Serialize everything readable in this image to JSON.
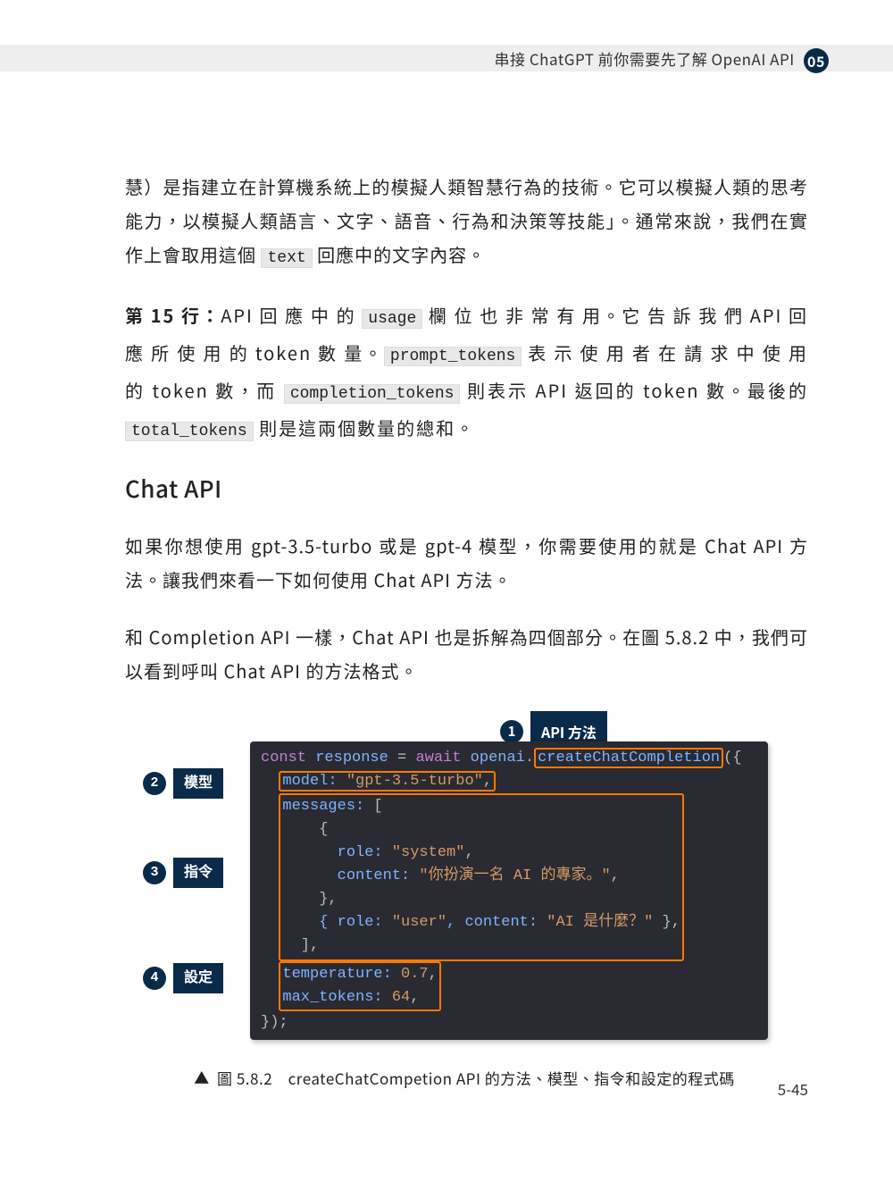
{
  "header": {
    "breadcrumb": "串接 ChatGPT 前你需要先了解 OpenAI API",
    "chapter_badge": "05"
  },
  "body": {
    "p1_a": "慧）是指建立在計算機系統上的模擬人類智慧行為的技術。它可以模擬人類的思考能力，以模擬人類語言、文字、語音、行為和決策等技能」。通常來說，我們在實作上會取用這個 ",
    "p1_code": "text",
    "p1_b": " 回應中的文字內容。",
    "p2_bold": "第 15 行：",
    "p2_a": "API 回 應 中 的 ",
    "p2_code1": "usage",
    "p2_b": " 欄 位 也 非 常 有 用。它 告 訴 我 們 API 回應 所 使 用 的 token 數 量。",
    "p2_code2": "prompt_tokens",
    "p2_c": " 表 示 使 用 者 在 請 求 中 使 用 的 token 數，而 ",
    "p2_code3": "completion_tokens",
    "p2_d": " 則表示 API 返回的 token 數。最後的 ",
    "p2_code4": "total_tokens",
    "p2_e": " 則是這兩個數量的總和。",
    "h2": "Chat API",
    "p3": "如果你想使用 gpt-3.5-turbo 或是 gpt-4 模型，你需要使用的就是 Chat API 方法。讓我們來看一下如何使用 Chat API 方法。",
    "p4": "和 Completion API 一樣，Chat API 也是拆解為四個部分。在圖 5.8.2 中，我們可以看到呼叫 Chat API 的方法格式。"
  },
  "figure": {
    "callouts": {
      "c1_num": "1",
      "c1_label": "API 方法",
      "c2_num": "2",
      "c2_label": "模型",
      "c3_num": "3",
      "c3_label": "指令",
      "c4_num": "4",
      "c4_label": "設定"
    },
    "code": {
      "l1_a": "const",
      "l1_b": " response ",
      "l1_c": "=",
      "l1_d": " await",
      "l1_e": " openai.",
      "l1_f": "createChatCompletion",
      "l1_g": "({",
      "l2_a": "model:",
      "l2_b": " \"gpt-3.5-turbo\"",
      "l2_c": ",",
      "l3_a": "messages:",
      "l3_b": " [",
      "l4": "    {",
      "l5_a": "      role:",
      "l5_b": " \"system\"",
      "l5_c": ",",
      "l6_a": "      content:",
      "l6_b": " \"你扮演一名 AI 的專家。\"",
      "l6_c": ",",
      "l7": "    },",
      "l8_a": "    { role:",
      "l8_b": " \"user\"",
      "l8_c": ", content:",
      "l8_d": " \"AI 是什麼？\"",
      "l8_e": " },",
      "l9": "  ],",
      "l10_a": "temperature:",
      "l10_b": " 0.7",
      "l10_c": ",",
      "l11_a": "max_tokens:",
      "l11_b": " 64",
      "l11_c": ",",
      "l12": "});"
    },
    "caption_tri": "▲",
    "caption": " 圖 5.8.2　createChatCompetion API 的方法、模型、指令和設定的程式碼"
  },
  "page_number": "5-45"
}
